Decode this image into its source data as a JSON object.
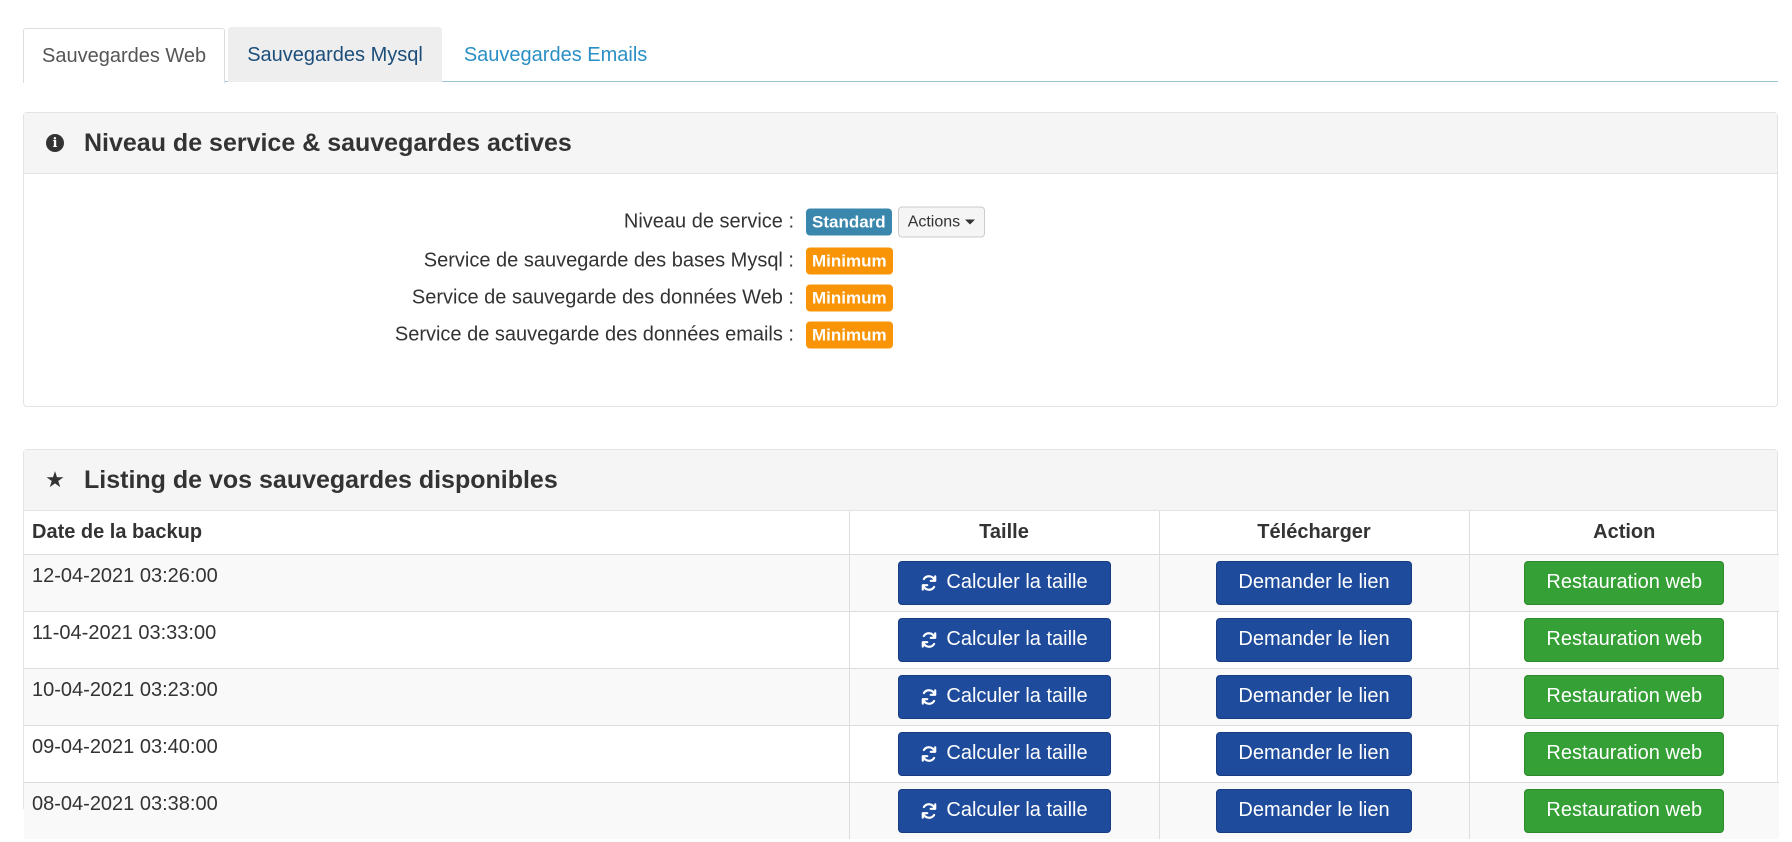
{
  "tabs": [
    {
      "label": "Sauvegardes Web"
    },
    {
      "label": "Sauvegardes Mysql"
    },
    {
      "label": "Sauvegardes Emails"
    }
  ],
  "service_panel": {
    "title": "Niveau de service & sauvegardes actives",
    "icon": "info-icon",
    "rows": [
      {
        "label": "Niveau de service :",
        "badge": "Standard",
        "action_label": "Actions"
      },
      {
        "label": "Service de sauvegarde des bases Mysql :",
        "badge": "Minimum"
      },
      {
        "label": "Service de sauvegarde des données Web :",
        "badge": "Minimum"
      },
      {
        "label": "Service de sauvegarde des données emails :",
        "badge": "Minimum"
      }
    ]
  },
  "listing_panel": {
    "title": "Listing de vos sauvegardes disponibles",
    "icon": "star-icon",
    "columns": [
      "Date de la backup",
      "Taille",
      "Télécharger",
      "Action"
    ],
    "rows": [
      {
        "date": "12-04-2021 03:26:00",
        "size_btn": "Calculer la taille",
        "download_btn": "Demander le lien",
        "action_btn": "Restauration web"
      },
      {
        "date": "11-04-2021 03:33:00",
        "size_btn": "Calculer la taille",
        "download_btn": "Demander le lien",
        "action_btn": "Restauration web"
      },
      {
        "date": "10-04-2021 03:23:00",
        "size_btn": "Calculer la taille",
        "download_btn": "Demander le lien",
        "action_btn": "Restauration web"
      },
      {
        "date": "09-04-2021 03:40:00",
        "size_btn": "Calculer la taille",
        "download_btn": "Demander le lien",
        "action_btn": "Restauration web"
      },
      {
        "date": "08-04-2021 03:38:00",
        "size_btn": "Calculer la taille",
        "download_btn": "Demander le lien",
        "action_btn": "Restauration web"
      }
    ]
  },
  "colors": {
    "badge_standard": "#3a87ad",
    "badge_minimum": "#f89406",
    "button_primary": "#1f4b9c",
    "button_success": "#35a035",
    "tab_link": "#2a8fc5"
  }
}
